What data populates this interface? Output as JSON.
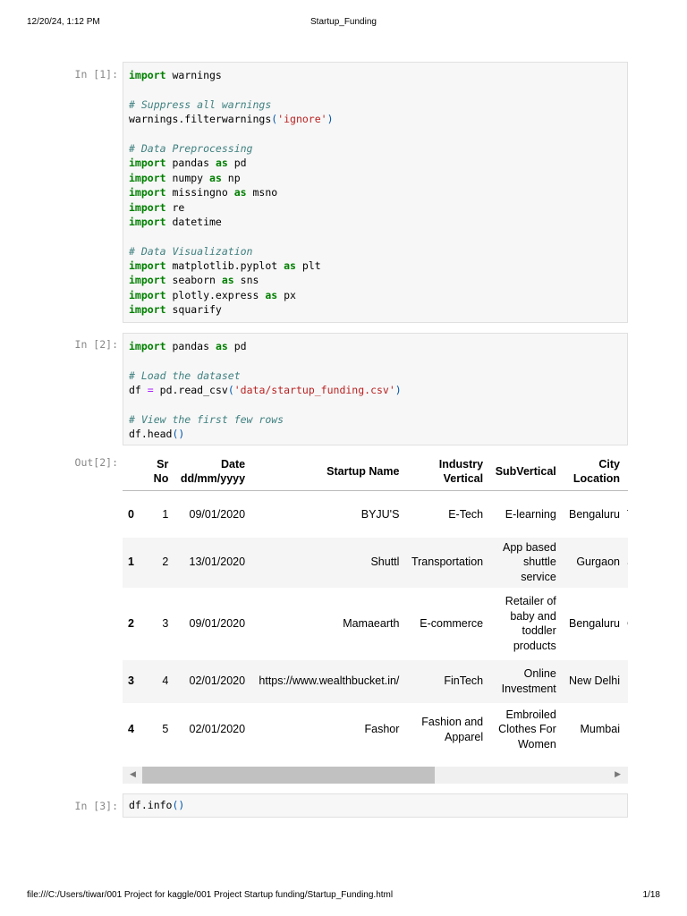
{
  "header": {
    "datetime": "12/20/24, 1:12 PM",
    "title": "Startup_Funding"
  },
  "footer": {
    "path": "file:///C:/Users/tiwar/001 Project for kaggle/001 Project Startup funding/Startup_Funding.html",
    "page": "1/18"
  },
  "cells": [
    {
      "prompt": "In [1]:",
      "lines": [
        [
          [
            "kw",
            "import"
          ],
          [
            "tx",
            " warnings"
          ]
        ],
        [],
        [
          [
            "cm",
            "# Suppress all warnings"
          ]
        ],
        [
          [
            "tx",
            "warnings.filterwarnings"
          ],
          [
            "pn",
            "("
          ],
          [
            "st",
            "'ignore'"
          ],
          [
            "pn",
            ")"
          ]
        ],
        [],
        [
          [
            "cm",
            "# Data Preprocessing"
          ]
        ],
        [
          [
            "kw",
            "import"
          ],
          [
            "tx",
            " pandas "
          ],
          [
            "kw",
            "as"
          ],
          [
            "tx",
            " pd"
          ]
        ],
        [
          [
            "kw",
            "import"
          ],
          [
            "tx",
            " numpy "
          ],
          [
            "kw",
            "as"
          ],
          [
            "tx",
            " np"
          ]
        ],
        [
          [
            "kw",
            "import"
          ],
          [
            "tx",
            " missingno "
          ],
          [
            "kw",
            "as"
          ],
          [
            "tx",
            " msno"
          ]
        ],
        [
          [
            "kw",
            "import"
          ],
          [
            "tx",
            " re"
          ]
        ],
        [
          [
            "kw",
            "import"
          ],
          [
            "tx",
            " datetime"
          ]
        ],
        [],
        [
          [
            "cm",
            "# Data Visualization"
          ]
        ],
        [
          [
            "kw",
            "import"
          ],
          [
            "tx",
            " matplotlib.pyplot "
          ],
          [
            "kw",
            "as"
          ],
          [
            "tx",
            " plt"
          ]
        ],
        [
          [
            "kw",
            "import"
          ],
          [
            "tx",
            " seaborn "
          ],
          [
            "kw",
            "as"
          ],
          [
            "tx",
            " sns"
          ]
        ],
        [
          [
            "kw",
            "import"
          ],
          [
            "tx",
            " plotly.express "
          ],
          [
            "kw",
            "as"
          ],
          [
            "tx",
            " px"
          ]
        ],
        [
          [
            "kw",
            "import"
          ],
          [
            "tx",
            " squarify"
          ]
        ]
      ]
    },
    {
      "prompt": "In [2]:",
      "lines": [
        [
          [
            "kw",
            "import"
          ],
          [
            "tx",
            " pandas "
          ],
          [
            "kw",
            "as"
          ],
          [
            "tx",
            " pd"
          ]
        ],
        [],
        [
          [
            "cm",
            "# Load the dataset"
          ]
        ],
        [
          [
            "tx",
            "df "
          ],
          [
            "op",
            "="
          ],
          [
            "tx",
            " pd.read_csv"
          ],
          [
            "pn",
            "("
          ],
          [
            "st",
            "'data/startup_funding.csv'"
          ],
          [
            "pn",
            ")"
          ]
        ],
        [],
        [
          [
            "cm",
            "# View the first few rows"
          ]
        ],
        [
          [
            "tx",
            "df.head"
          ],
          [
            "pn",
            "()"
          ]
        ]
      ]
    },
    {
      "prompt": "In [3]:",
      "lines": [
        [
          [
            "tx",
            "df.info"
          ],
          [
            "pn",
            "()"
          ]
        ]
      ]
    }
  ],
  "output": {
    "prompt": "Out[2]:",
    "columns": [
      "",
      "Sr No",
      "Date dd/mm/yyyy",
      "Startup Name",
      "Industry Vertical",
      "SubVertical",
      "City Location",
      ""
    ],
    "rows": [
      [
        "0",
        "1",
        "09/01/2020",
        "BYJU'S",
        "E-Tech",
        "E-learning",
        "Bengaluru",
        "Ti Ma"
      ],
      [
        "1",
        "2",
        "13/01/2020",
        "Shuttl",
        "Transportation",
        "App based shuttle service",
        "Gurgaon",
        "Sus"
      ],
      [
        "2",
        "3",
        "09/01/2020",
        "Mamaearth",
        "E-commerce",
        "Retailer of baby and toddler products",
        "Bengaluru",
        "Ca"
      ],
      [
        "3",
        "4",
        "02/01/2020",
        "https://www.wealthbucket.in/",
        "FinTech",
        "Online Investment",
        "New Delhi",
        ""
      ],
      [
        "4",
        "5",
        "02/01/2020",
        "Fashor",
        "Fashion and Apparel",
        "Embroiled Clothes For Women",
        "Mumbai",
        ""
      ]
    ],
    "scroll_fraction": 0.6
  }
}
